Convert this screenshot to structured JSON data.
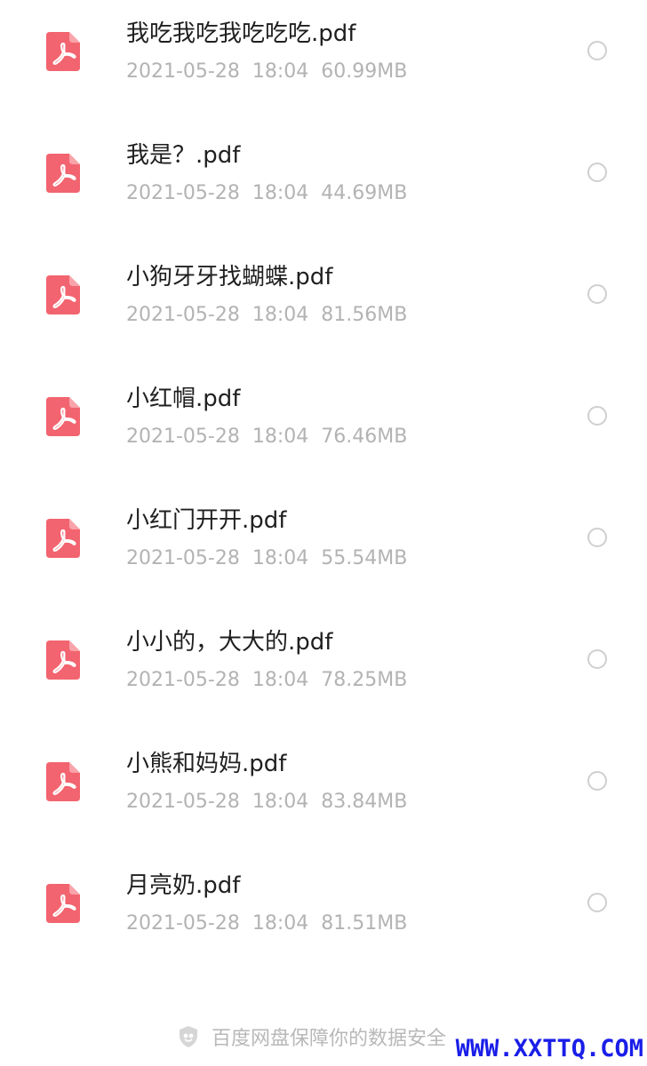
{
  "files": [
    {
      "name": "我吃我吃我吃吃吃.pdf",
      "date": "2021-05-28",
      "time": "18:04",
      "size": "60.99MB",
      "selected": false
    },
    {
      "name": "我是？.pdf",
      "date": "2021-05-28",
      "time": "18:04",
      "size": "44.69MB",
      "selected": false
    },
    {
      "name": "小狗牙牙找蝴蝶.pdf",
      "date": "2021-05-28",
      "time": "18:04",
      "size": "81.56MB",
      "selected": false
    },
    {
      "name": "小红帽.pdf",
      "date": "2021-05-28",
      "time": "18:04",
      "size": "76.46MB",
      "selected": false
    },
    {
      "name": "小红门开开.pdf",
      "date": "2021-05-28",
      "time": "18:04",
      "size": "55.54MB",
      "selected": false
    },
    {
      "name": "小小的，大大的.pdf",
      "date": "2021-05-28",
      "time": "18:04",
      "size": "78.25MB",
      "selected": false
    },
    {
      "name": "小熊和妈妈.pdf",
      "date": "2021-05-28",
      "time": "18:04",
      "size": "83.84MB",
      "selected": false
    },
    {
      "name": "月亮奶.pdf",
      "date": "2021-05-28",
      "time": "18:04",
      "size": "81.51MB",
      "selected": false
    }
  ],
  "footer": {
    "icon": "shield-icon",
    "text": "百度网盘保障你的数据安全"
  },
  "watermark": "WWW.XXTTQ.COM",
  "colors": {
    "pdf_icon": "#f2646f",
    "radio_border": "#cfcfcf",
    "meta_text": "#b3b3b3",
    "watermark": "#1a1ee8"
  }
}
